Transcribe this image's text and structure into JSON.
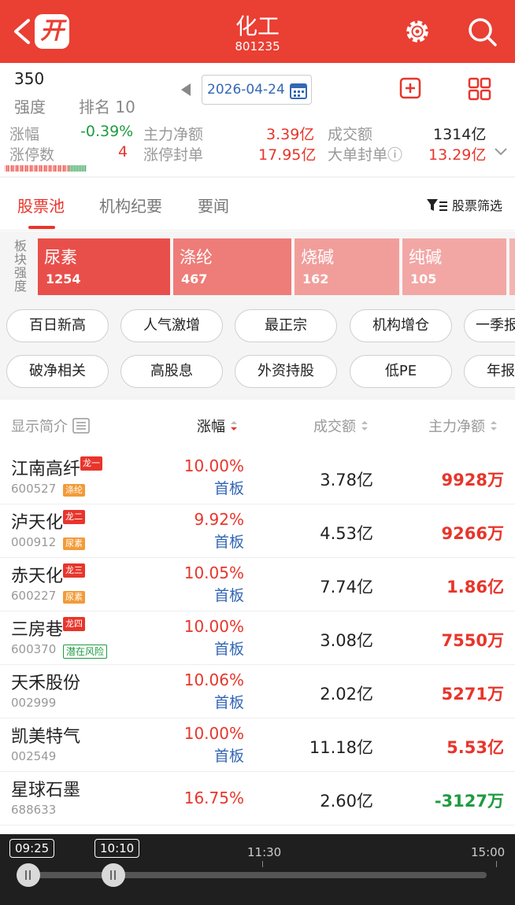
{
  "header": {
    "title": "化工",
    "code": "801235"
  },
  "stats": {
    "strength_value": "350",
    "strength_label": "强度",
    "rank_label": "排名 10",
    "date": "2026-04-24",
    "rows": [
      {
        "l1": "涨幅",
        "v1": "-0.39%",
        "l2": "主力净额",
        "v2": "3.39亿",
        "l3": "成交额",
        "v3": "1314亿"
      },
      {
        "l1": "涨停数",
        "v1": "4",
        "l2": "涨停封单",
        "v2": "17.95亿",
        "l3": "大单封单ⓘ",
        "v3": "13.29亿"
      }
    ]
  },
  "tabs": [
    "股票池",
    "机构纪要",
    "要闻"
  ],
  "filter_label": "股票筛选",
  "sector_label": "板块强度",
  "sectors": [
    {
      "name": "尿素",
      "value": "1254",
      "color": "#e94f4a"
    },
    {
      "name": "涤纶",
      "value": "467",
      "color": "#ee7c78"
    },
    {
      "name": "烧碱",
      "value": "162",
      "color": "#f19e9b"
    },
    {
      "name": "纯碱",
      "value": "105",
      "color": "#f2a7a5"
    }
  ],
  "chips_row1": [
    "百日新高",
    "人气激增",
    "最正宗",
    "机构增仓",
    "一季报"
  ],
  "chips_row2": [
    "破净相关",
    "高股息",
    "外资持股",
    "低PE",
    "年报"
  ],
  "table": {
    "headers": [
      "显示简介",
      "涨幅",
      "成交额",
      "主力净额"
    ],
    "rows": [
      {
        "name": "江南高纤",
        "dragon": "龙一",
        "code": "600527",
        "tag": "涤纶",
        "tag_type": "orange",
        "chg": "10.00%",
        "sub": "首板",
        "amt": "3.78亿",
        "net": "9928万",
        "net_color": "#e8352b"
      },
      {
        "name": "泸天化",
        "dragon": "龙二",
        "code": "000912",
        "tag": "尿素",
        "tag_type": "orange",
        "chg": "9.92%",
        "sub": "首板",
        "amt": "4.53亿",
        "net": "9266万",
        "net_color": "#e8352b"
      },
      {
        "name": "赤天化",
        "dragon": "龙三",
        "code": "600227",
        "tag": "尿素",
        "tag_type": "orange",
        "chg": "10.05%",
        "sub": "首板",
        "amt": "7.74亿",
        "net": "1.86亿",
        "net_color": "#e8352b"
      },
      {
        "name": "三房巷",
        "dragon": "龙四",
        "code": "600370",
        "tag": "潜在风险",
        "tag_type": "risk",
        "chg": "10.00%",
        "sub": "首板",
        "amt": "3.08亿",
        "net": "7550万",
        "net_color": "#e8352b"
      },
      {
        "name": "天禾股份",
        "dragon": "",
        "code": "002999",
        "tag": "",
        "tag_type": "",
        "chg": "10.06%",
        "sub": "首板",
        "amt": "2.02亿",
        "net": "5271万",
        "net_color": "#e8352b"
      },
      {
        "name": "凯美特气",
        "dragon": "",
        "code": "002549",
        "tag": "",
        "tag_type": "",
        "chg": "10.00%",
        "sub": "首板",
        "amt": "11.18亿",
        "net": "5.53亿",
        "net_color": "#e8352b"
      },
      {
        "name": "星球石墨",
        "dragon": "",
        "code": "688633",
        "tag": "",
        "tag_type": "",
        "chg": "16.75%",
        "sub": "",
        "amt": "2.60亿",
        "net": "-3127万",
        "net_color": "#1e9b40"
      }
    ]
  },
  "timeline": {
    "start_label": "09:25",
    "current_label": "10:10",
    "mid_label": "11:30",
    "end_label": "15:00"
  }
}
